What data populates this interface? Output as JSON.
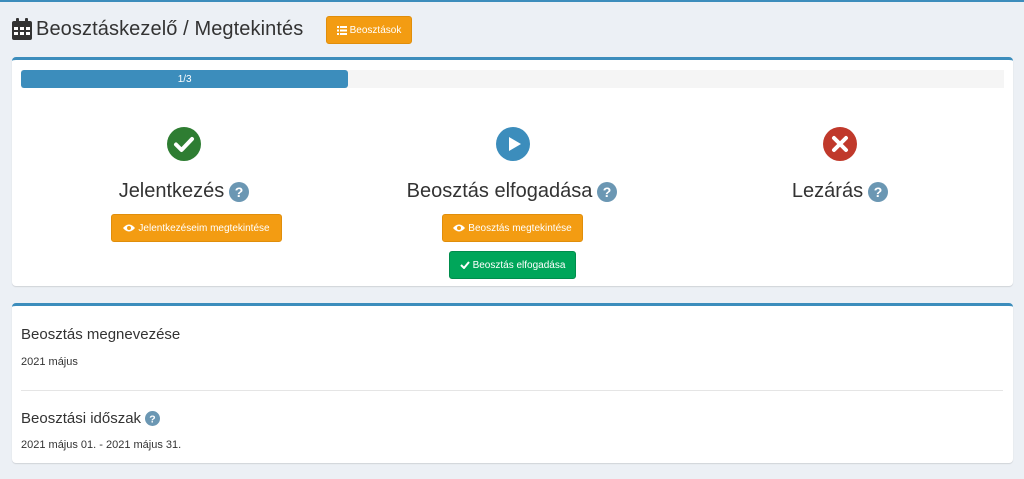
{
  "header": {
    "title": "Beosztáskezelő / Megtekintés",
    "list_button": "Beosztások"
  },
  "progress": {
    "label": "1/3",
    "value": 0.333
  },
  "steps": [
    {
      "title": "Jelentkezés",
      "status": "done",
      "status_icon": "check-circle-icon",
      "status_color": "#2e7d32",
      "buttons": [
        {
          "label": "Jelentkezéseim megtekintése",
          "icon": "eye-icon"
        }
      ]
    },
    {
      "title": "Beosztás elfogadása",
      "status": "current",
      "status_icon": "play-circle-icon",
      "status_color": "#3c8dbc",
      "buttons": [
        {
          "label": "Beosztás megtekintése",
          "icon": "eye-icon"
        },
        {
          "label": "Beosztás elfogadása",
          "icon": "check-icon"
        }
      ]
    },
    {
      "title": "Lezárás",
      "status": "pending",
      "status_icon": "times-circle-icon",
      "status_color": "#c0392b",
      "buttons": []
    }
  ],
  "details": {
    "name_label": "Beosztás megnevezése",
    "name_value": "2021 május",
    "period_label": "Beosztási időszak",
    "period_value": "2021 május 01. - 2021 május 31."
  },
  "colors": {
    "primary": "#3c8dbc",
    "warning": "#f39c12",
    "success": "#00a65a",
    "danger": "#c0392b",
    "help": "#6b97b3"
  }
}
